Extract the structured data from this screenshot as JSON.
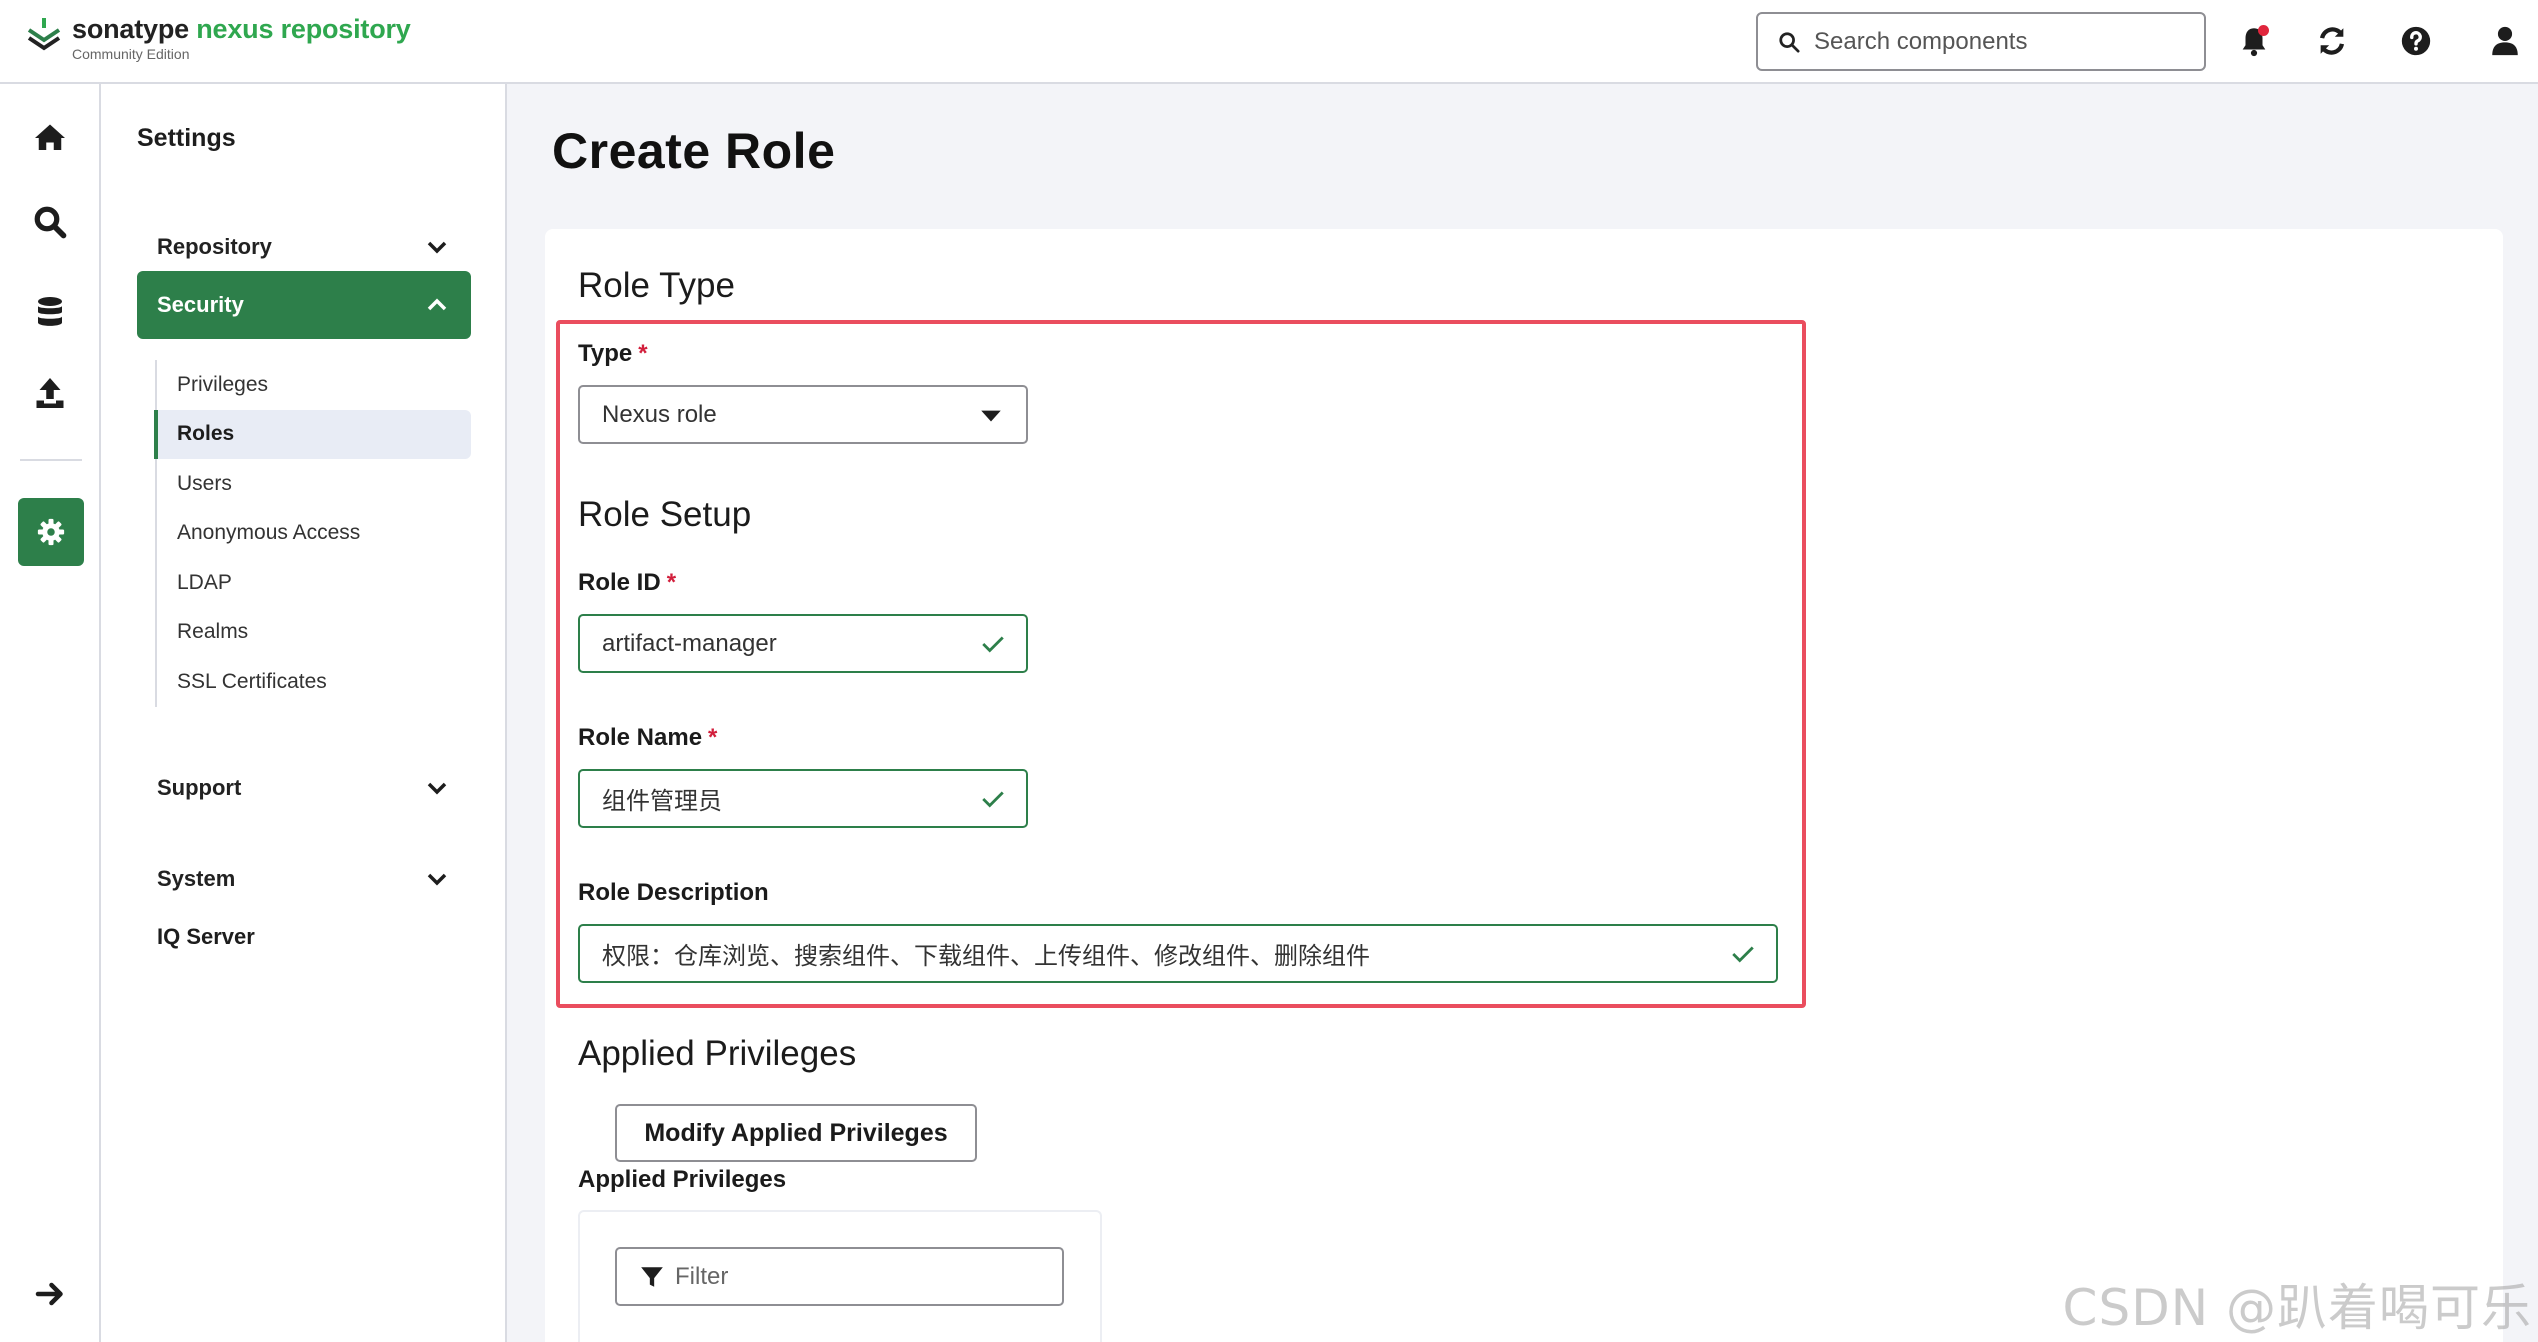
{
  "header": {
    "brand_part1": "sonatype",
    "brand_part2": "nexus repository",
    "edition": "Community Edition",
    "search_placeholder": "Search components",
    "icons": [
      "bell-icon",
      "refresh-icon",
      "help-icon",
      "user-icon"
    ]
  },
  "rail": {
    "icons": [
      "home-icon",
      "search-icon",
      "database-icon",
      "upload-icon",
      "gear-icon",
      "arrow-right-icon"
    ]
  },
  "sidebar": {
    "title": "Settings",
    "groups": {
      "repository": "Repository",
      "security": "Security",
      "support": "Support",
      "system": "System",
      "iq_server": "IQ Server"
    },
    "security_items": [
      "Privileges",
      "Roles",
      "Users",
      "Anonymous Access",
      "LDAP",
      "Realms",
      "SSL Certificates"
    ],
    "active_item": "Roles"
  },
  "main": {
    "page_title": "Create Role",
    "role_type": {
      "heading": "Role Type",
      "type_label": "Type",
      "type_value": "Nexus role"
    },
    "role_setup": {
      "heading": "Role Setup",
      "role_id_label": "Role ID",
      "role_id_value": "artifact-manager",
      "role_name_label": "Role Name",
      "role_name_value": "组件管理员",
      "role_desc_label": "Role Description",
      "role_desc_value": "权限：仓库浏览、搜索组件、下载组件、上传组件、修改组件、删除组件"
    },
    "applied_privileges": {
      "heading": "Applied Privileges",
      "modify_button": "Modify Applied Privileges",
      "list_label": "Applied Privileges",
      "filter_placeholder": "Filter"
    },
    "required_mark": "*"
  },
  "watermark": "CSDN @趴着喝可乐",
  "colors": {
    "accent_green": "#2d7f4a",
    "brand_green": "#2fa74f",
    "highlight_red": "#ea4d5e",
    "required_red": "#d21f3c"
  }
}
